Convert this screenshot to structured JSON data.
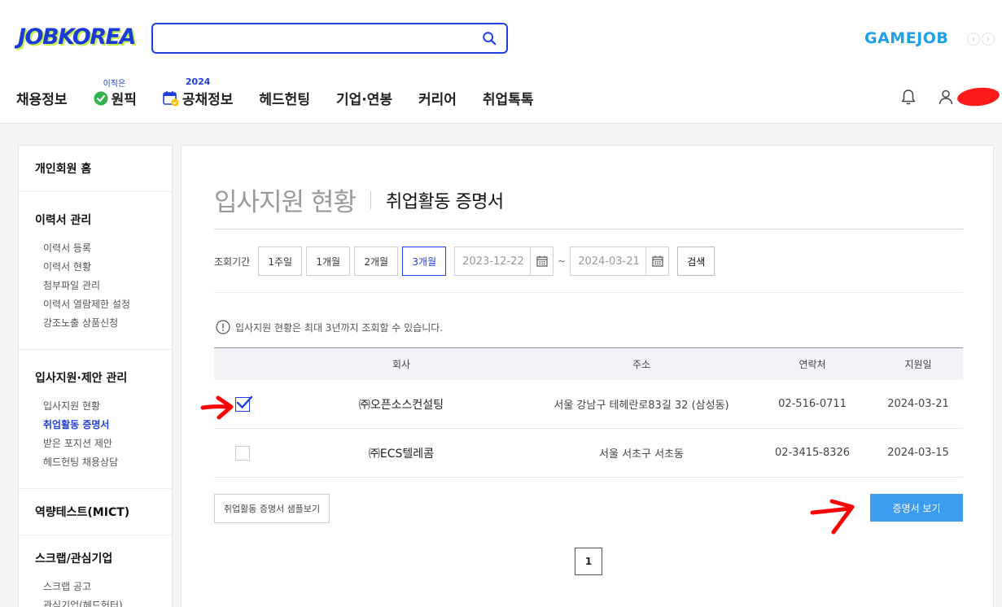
{
  "header": {
    "logo": "JOBKOREA",
    "search_placeholder": "",
    "gamejob": "GAMEJOB",
    "nav": [
      {
        "label": "채용정보"
      },
      {
        "label": "원픽",
        "tag": "이직은"
      },
      {
        "label": "공채정보",
        "tag": "2024"
      },
      {
        "label": "헤드헌팅"
      },
      {
        "label": "기업·연봉"
      },
      {
        "label": "커리어"
      },
      {
        "label": "취업톡톡"
      }
    ]
  },
  "sidebar": {
    "sections": [
      {
        "title": "개인회원 홈",
        "items": []
      },
      {
        "title": "이력서 관리",
        "items": [
          "이력서 등록",
          "이력서 현황",
          "첨부파일 관리",
          "이력서 열람제한 설정",
          "강조노출 상품신청"
        ]
      },
      {
        "title": "입사지원·제안 관리",
        "items": [
          "입사지원 현황",
          "취업활동 증명서",
          "받은 포지션 제안",
          "헤드헌팅 채용상담"
        ]
      },
      {
        "title": "역량테스트(MICT)",
        "items": []
      },
      {
        "title": "스크랩/관심기업",
        "items": [
          "스크랩 공고",
          "관심기업(헤드헌터)"
        ]
      }
    ],
    "active_item": "취업활동 증명서"
  },
  "main": {
    "title": "입사지원 현황",
    "subtitle": "취업활동 증명서",
    "filter": {
      "label": "조회기간",
      "periods": [
        "1주일",
        "1개월",
        "2개월",
        "3개월"
      ],
      "active_period": "3개월",
      "date_from": "2023-12-22",
      "date_to": "2024-03-21",
      "tilde": "~",
      "search_label": "검색"
    },
    "notice": "입사지원 현황은 최대 3년까지 조회할 수 있습니다.",
    "table": {
      "headers": [
        "회사",
        "주소",
        "연락처",
        "지원일"
      ],
      "rows": [
        {
          "company": "㈜오픈소스컨설팅",
          "address": "서울 강남구 테헤란로83길 32 (삼성동)",
          "tel": "02-516-0711",
          "date": "2024-03-21",
          "checked": true
        },
        {
          "company": "㈜ECS텔레콤",
          "address": "서울 서초구 서초동",
          "tel": "02-3415-8326",
          "date": "2024-03-15",
          "checked": false
        }
      ]
    },
    "sample_button": "취업활동 증명서 샘플보기",
    "view_button": "증명서 보기",
    "page": "1"
  },
  "colors": {
    "brand_blue": "#1f3fe0",
    "view_button": "#3d9bf0",
    "annotation_red": "#ff0000"
  }
}
